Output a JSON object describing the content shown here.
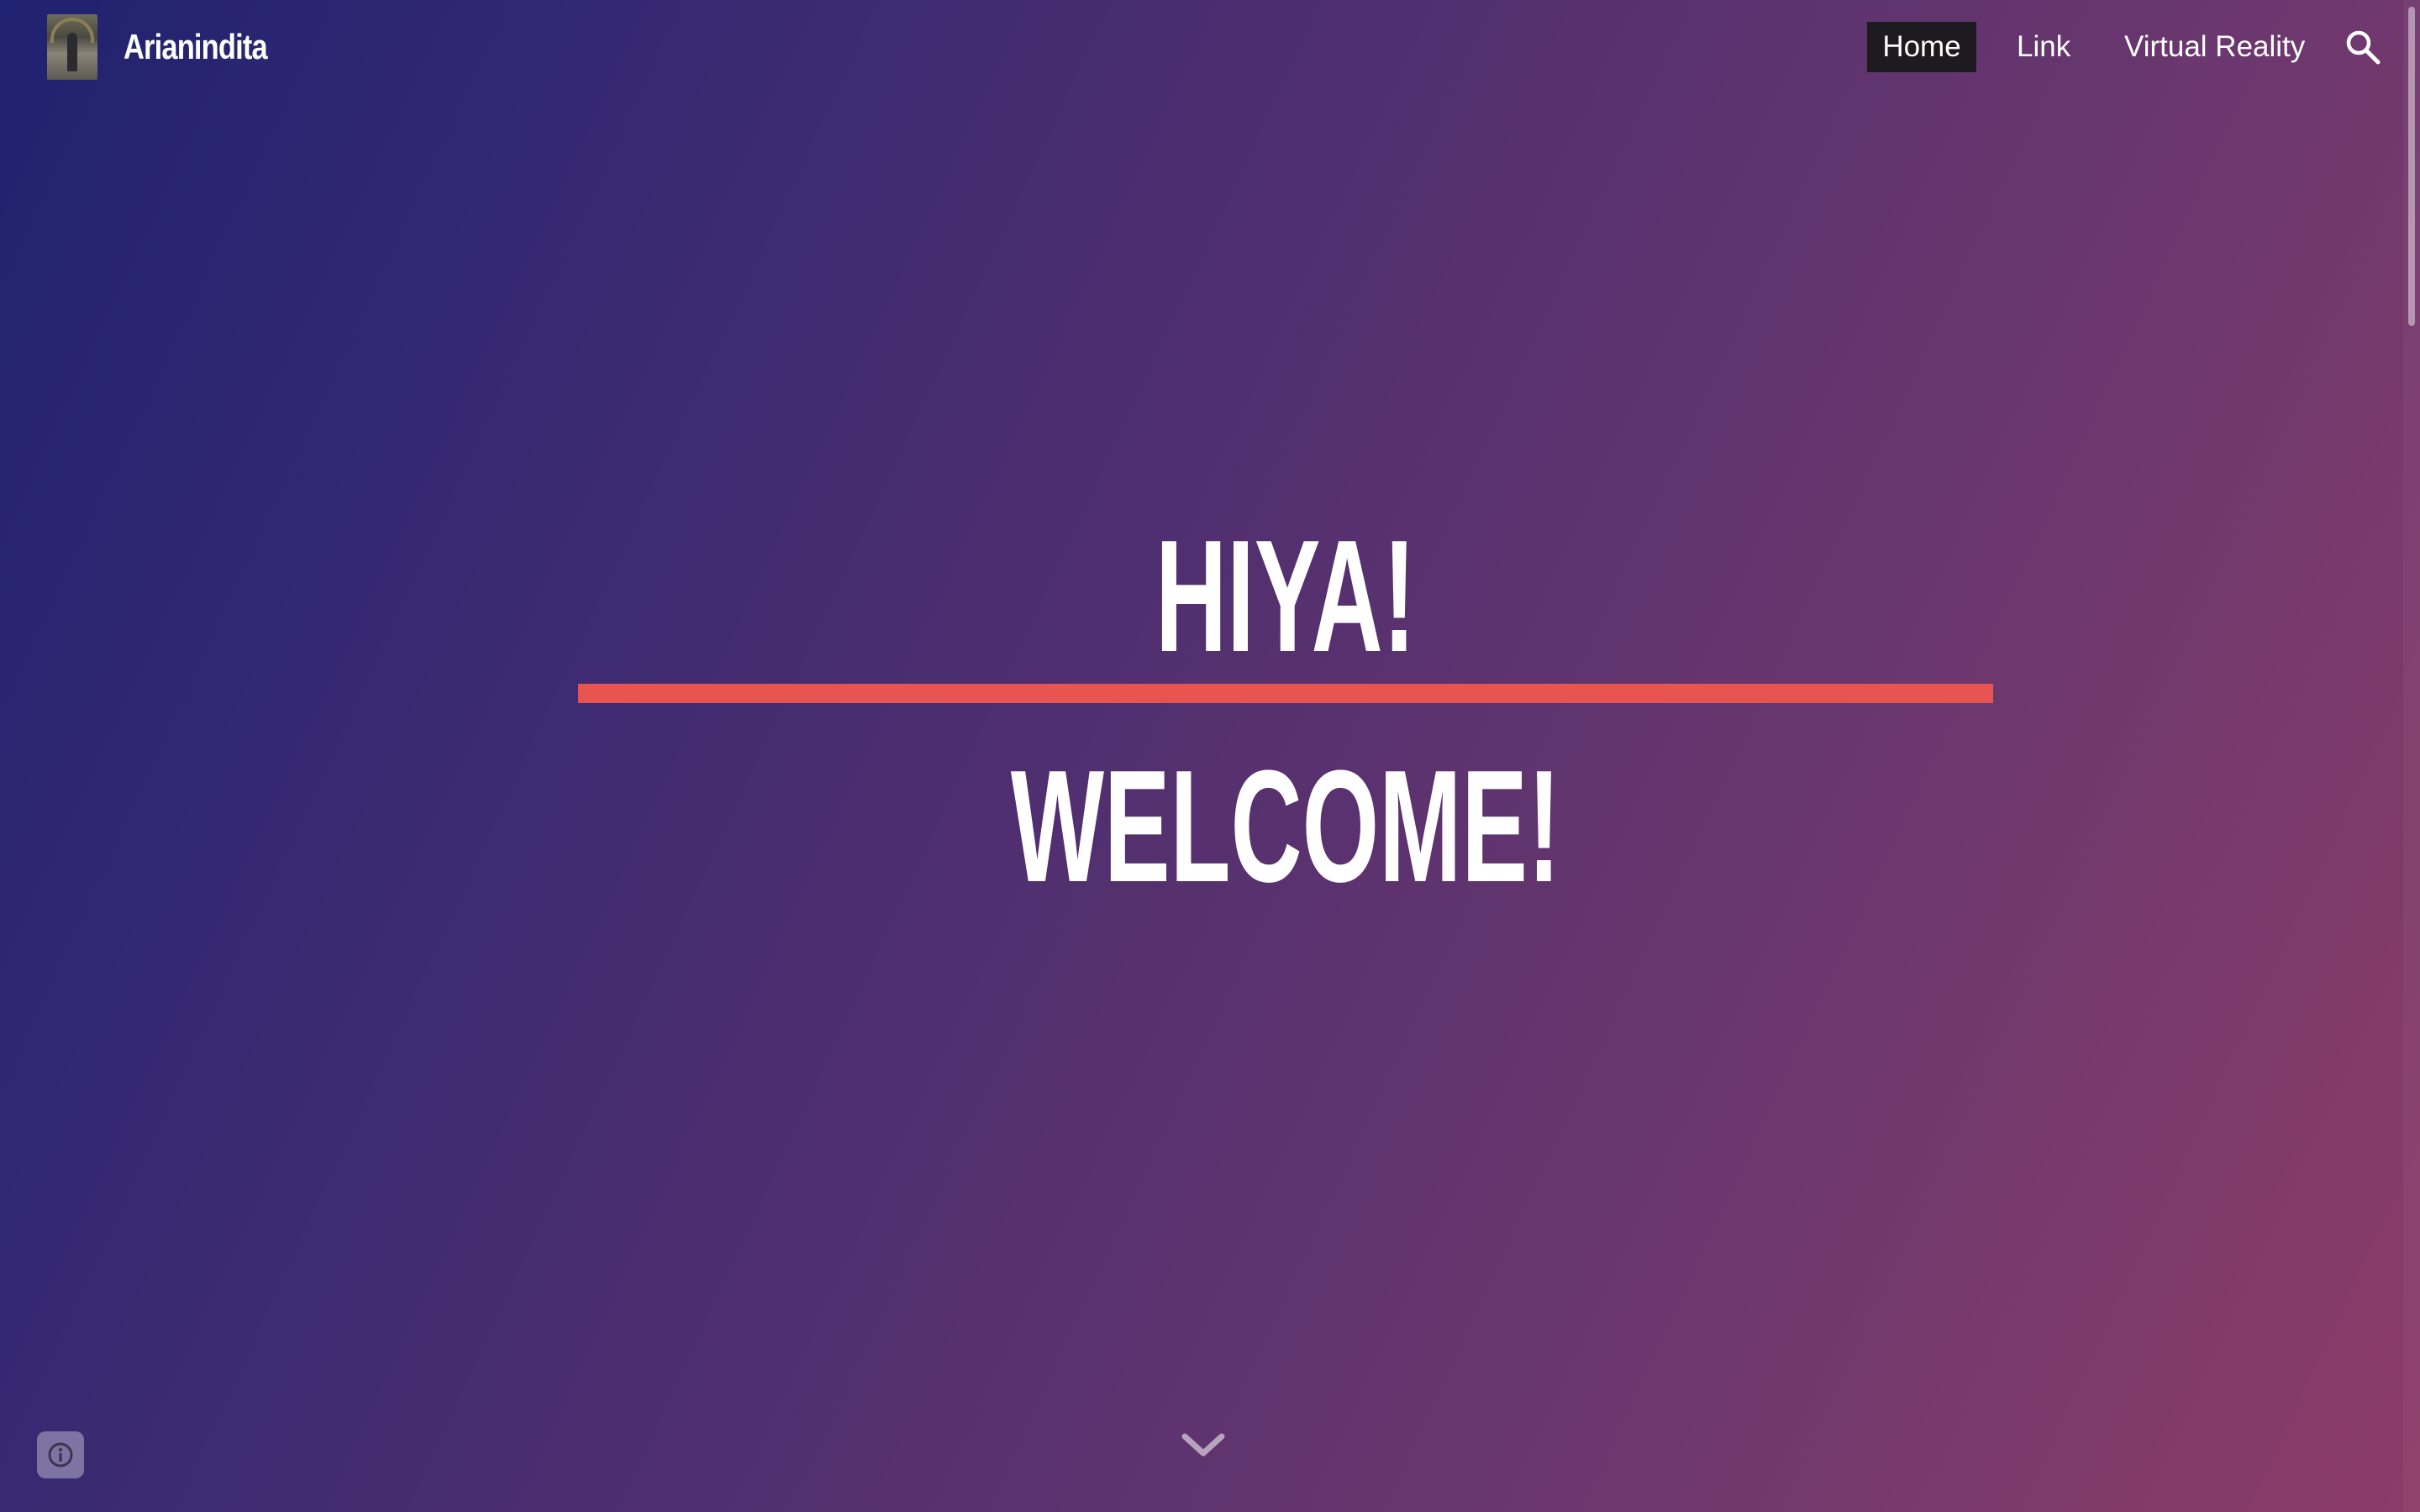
{
  "header": {
    "site_title": "Arianindita",
    "logo_icon": "site-logo-photo"
  },
  "nav": {
    "items": [
      {
        "label": "Home",
        "active": true
      },
      {
        "label": "Link",
        "active": false
      },
      {
        "label": "Virtual Reality",
        "active": false
      }
    ],
    "search_icon": "search-icon"
  },
  "hero": {
    "line1": "HIYA!",
    "line2": "WELCOME!",
    "divider_color": "#e8544f"
  },
  "footer": {
    "scroll_icon": "chevron-down-icon",
    "info_icon": "info-icon"
  },
  "colors": {
    "gradient_start": "#1f2270",
    "gradient_end": "#8c3c68",
    "active_nav_bg": "#1d1b1f",
    "text": "#ffffff"
  }
}
